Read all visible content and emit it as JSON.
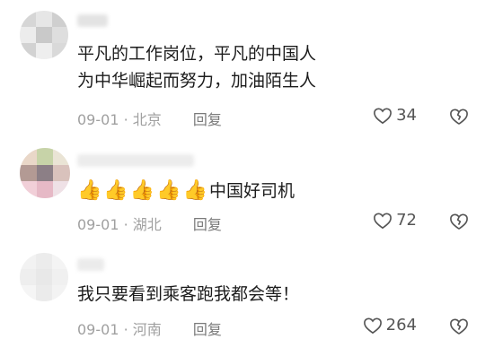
{
  "comments": [
    {
      "text_lines": [
        "平凡的工作岗位，平凡的中国人",
        "为中华崛起而努力，加油陌生人"
      ],
      "date": "09-01",
      "location": "北京",
      "reply_label": "回复",
      "likes": "34"
    },
    {
      "emoji": [
        "👍",
        "👍",
        "👍",
        "👍",
        "👍"
      ],
      "text": "中国好司机",
      "date": "09-01",
      "location": "湖北",
      "reply_label": "回复",
      "likes": "72"
    },
    {
      "text": "我只要看到乘客跑我都会等！",
      "date": "09-01",
      "location": "河南",
      "reply_label": "回复",
      "likes": "264"
    }
  ],
  "icons": {
    "like": "heart-outline-icon",
    "dislike": "broken-heart-icon"
  }
}
